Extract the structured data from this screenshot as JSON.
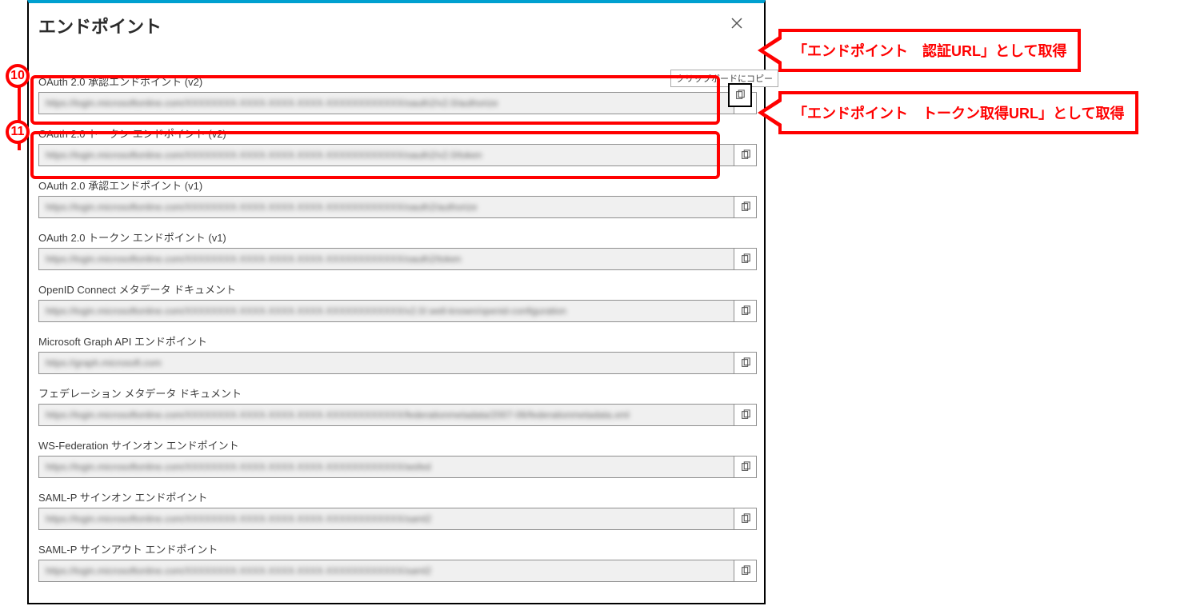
{
  "dialog_title": "エンドポイント",
  "tooltip_text": "クリップボードにコピー",
  "endpoints": [
    {
      "label": "OAuth 2.0 承認エンドポイント (v2)",
      "value": "https://login.microsoftonline.com/XXXXXXXX-XXXX-XXXX-XXXX-XXXXXXXXXXXX/oauth2/v2.0/authorize"
    },
    {
      "label": "OAuth 2.0 トークン エンドポイント (v2)",
      "value": "https://login.microsoftonline.com/XXXXXXXX-XXXX-XXXX-XXXX-XXXXXXXXXXXX/oauth2/v2.0/token"
    },
    {
      "label": "OAuth 2.0 承認エンドポイント (v1)",
      "value": "https://login.microsoftonline.com/XXXXXXXX-XXXX-XXXX-XXXX-XXXXXXXXXXXX/oauth2/authorize"
    },
    {
      "label": "OAuth 2.0 トークン エンドポイント (v1)",
      "value": "https://login.microsoftonline.com/XXXXXXXX-XXXX-XXXX-XXXX-XXXXXXXXXXXX/oauth2/token"
    },
    {
      "label": "OpenID Connect メタデータ ドキュメント",
      "value": "https://login.microsoftonline.com/XXXXXXXX-XXXX-XXXX-XXXX-XXXXXXXXXXXX/v2.0/.well-known/openid-configuration"
    },
    {
      "label": "Microsoft Graph API エンドポイント",
      "value": "https://graph.microsoft.com"
    },
    {
      "label": "フェデレーション メタデータ ドキュメント",
      "value": "https://login.microsoftonline.com/XXXXXXXX-XXXX-XXXX-XXXX-XXXXXXXXXXXX/federationmetadata/2007-06/federationmetadata.xml"
    },
    {
      "label": "WS-Federation サインオン エンドポイント",
      "value": "https://login.microsoftonline.com/XXXXXXXX-XXXX-XXXX-XXXX-XXXXXXXXXXXX/wsfed"
    },
    {
      "label": "SAML-P サインオン エンドポイント",
      "value": "https://login.microsoftonline.com/XXXXXXXX-XXXX-XXXX-XXXX-XXXXXXXXXXXX/saml2"
    },
    {
      "label": "SAML-P サインアウト エンドポイント",
      "value": "https://login.microsoftonline.com/XXXXXXXX-XXXX-XXXX-XXXX-XXXXXXXXXXXX/saml2"
    }
  ],
  "annotations": {
    "badge10": "10",
    "badge11": "11",
    "callout1": "「エンドポイント　認証URL」として取得",
    "callout2": "「エンドポイント　トークン取得URL」として取得"
  }
}
